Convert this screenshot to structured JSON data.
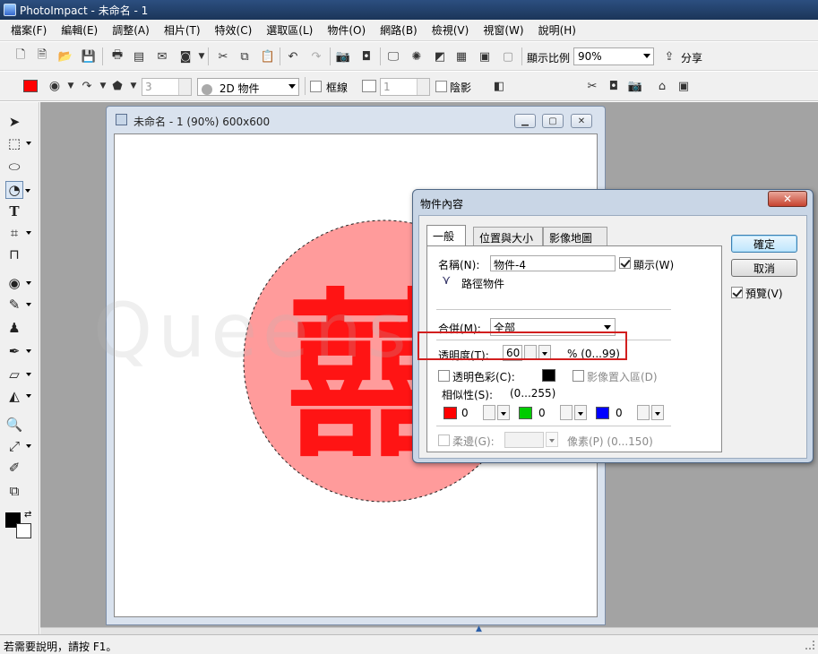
{
  "app": {
    "title": "PhotoImpact - 未命名 - 1"
  },
  "menu": [
    "檔案(F)",
    "編輯(E)",
    "調整(A)",
    "相片(T)",
    "特效(C)",
    "選取區(L)",
    "物件(O)",
    "網路(B)",
    "檢視(V)",
    "視窗(W)",
    "說明(H)"
  ],
  "toolbar1": {
    "zoom_label": "顯示比例",
    "zoom_value": "90%",
    "share_label": "分享"
  },
  "toolbar2": {
    "fill_color": "#ff0000",
    "width_value": "3",
    "mode_value": "2D 物件",
    "border_label": "框線",
    "border_width": "1",
    "shadow_label": "陰影"
  },
  "document": {
    "title": "未命名 - 1 (90%) 600x600",
    "text": "囍"
  },
  "watermark": "Queens Zakka",
  "dialog": {
    "title": "物件內容",
    "tabs": [
      "一般",
      "位置與大小",
      "影像地圖"
    ],
    "name_label": "名稱(N):",
    "name_value": "物件-4",
    "show_label": "顯示(W)",
    "path_object_label": "路徑物件",
    "merge_label": "合併(M):",
    "merge_value": "全部",
    "transparency_label": "透明度(T):",
    "transparency_value": "60",
    "transparency_range": "% (0...99)",
    "transparent_color_label": "透明色彩(C):",
    "image_in_label": "影像置入區(D)",
    "similarity_label": "相似性(S):",
    "similarity_range": "(0...255)",
    "rgb": [
      {
        "color": "#ff0000",
        "value": "0"
      },
      {
        "color": "#00cc00",
        "value": "0"
      },
      {
        "color": "#0000ff",
        "value": "0"
      }
    ],
    "soft_edge_label": "柔邊(G):",
    "pixel_label": "像素(P) (0...150)",
    "ok_label": "確定",
    "cancel_label": "取消",
    "preview_label": "預覽(V)"
  },
  "status": {
    "text": "若需要說明，請按 F1。"
  }
}
